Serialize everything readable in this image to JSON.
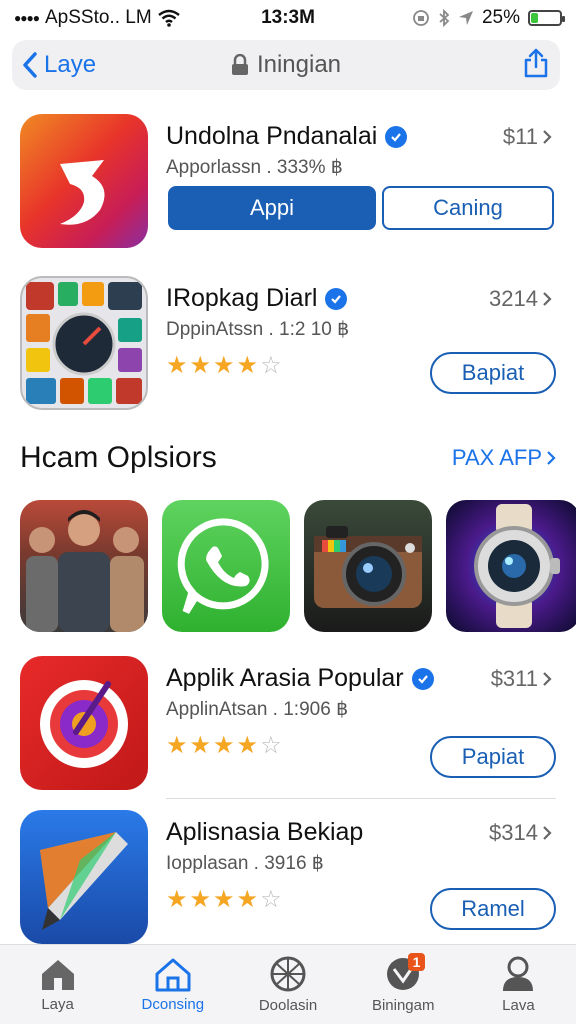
{
  "status_bar": {
    "carrier": "ApSSto.. LM",
    "time": "13:3M",
    "battery_percent": "25%",
    "battery_level": 0.25
  },
  "nav": {
    "back_label": "Laye",
    "title": "Iningian"
  },
  "apps_top": [
    {
      "name": "Undolna Pndanalai",
      "subtitle": "Apporlassn . 333% ฿",
      "price": "$11",
      "primary_button": "Appi",
      "secondary_button": "Caning"
    },
    {
      "name": "IRopkag Diarl",
      "subtitle": "DppinAtssn . 1:2 10 ฿",
      "price": "3214",
      "rating": 4,
      "button": "Bapiat"
    }
  ],
  "section": {
    "title": "Hcam Oplsiors",
    "link": "PAX AFP"
  },
  "carousel": [
    {
      "icon": "people-photo-icon"
    },
    {
      "icon": "whatsapp-phone-icon"
    },
    {
      "icon": "camera-app-icon"
    },
    {
      "icon": "smartwatch-icon"
    }
  ],
  "apps_bottom": [
    {
      "name": "Applik Arasia Popular",
      "subtitle": "ApplinAtsan . 1:906 ฿",
      "price": "$311",
      "rating": 4,
      "button": "Papiat",
      "verified": true
    },
    {
      "name": "Aplisnasia Bekiap",
      "subtitle": "Iopplasan . 3916 ฿",
      "price": "$314",
      "rating": 4,
      "button": "Ramel"
    }
  ],
  "tabs": [
    {
      "label": "Laya",
      "icon": "house-icon",
      "active": false
    },
    {
      "label": "Dconsing",
      "icon": "house-outline-icon",
      "active": true
    },
    {
      "label": "Doolasin",
      "icon": "globe-icon",
      "active": false
    },
    {
      "label": "Biningam",
      "icon": "compass-icon",
      "active": false,
      "badge": "1"
    },
    {
      "label": "Lava",
      "icon": "person-icon",
      "active": false
    }
  ],
  "colors": {
    "accent": "#1a73e8",
    "button_blue": "#1a5fb4",
    "star": "#f5a623",
    "badge": "#e8541a",
    "battery": "#3cc43c"
  }
}
